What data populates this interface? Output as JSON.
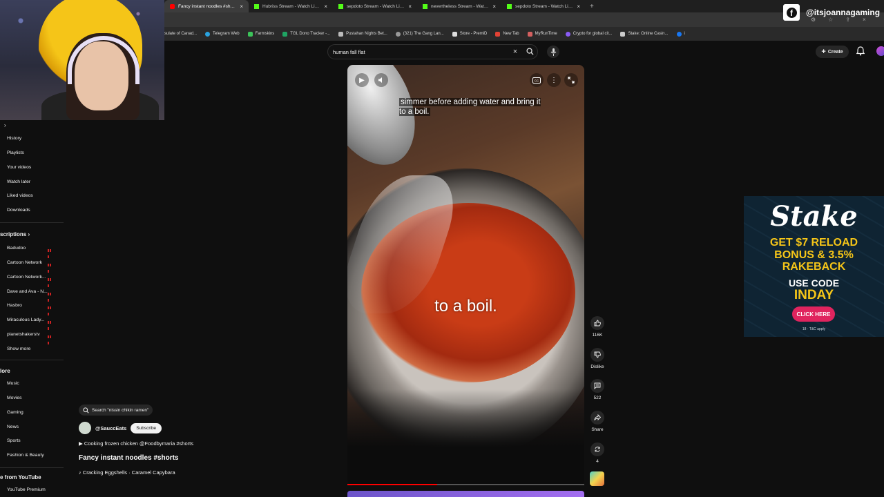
{
  "browser": {
    "tabs": [
      {
        "title": "Fancy instant noodles #shorts",
        "active": true,
        "icon": "youtube-icon"
      },
      {
        "title": "Hubriss Stream - Watch Live o",
        "active": false,
        "icon": "kick-icon"
      },
      {
        "title": "sepdoto Stream - Watch Live o",
        "active": false,
        "icon": "kick-icon"
      },
      {
        "title": "nevertheless Stream - Watch Li",
        "active": false,
        "icon": "kick-icon"
      },
      {
        "title": "sepdoto Stream - Watch Live o",
        "active": false,
        "icon": "kick-icon"
      }
    ],
    "new_tab": "+",
    "bookmarks": [
      {
        "label": "sulate of Canad...",
        "color": "#888888"
      },
      {
        "label": "Telegram Web",
        "color": "#2aa3e0"
      },
      {
        "label": "Farmskins",
        "color": "#3cc45a"
      },
      {
        "label": "TGL Dono Tracker -...",
        "color": "#1fa463"
      },
      {
        "label": "Pustahan Nights Bet...",
        "color": "#bbbbbb"
      },
      {
        "label": "(321) The Gang Lan...",
        "color": "#999999"
      },
      {
        "label": "Store - PremiD",
        "color": "#dddddd"
      },
      {
        "label": "New Tab",
        "color": "#e34234"
      },
      {
        "label": "MyRunTime",
        "color": "#d46060"
      },
      {
        "label": "Crypto for global cit...",
        "color": "#8a5cf5"
      },
      {
        "label": "Stake: Online Casin...",
        "color": "#cccccc"
      },
      {
        "label": "i",
        "color": "#1877f2"
      }
    ]
  },
  "overlay": {
    "facebook_handle": "@itsjoannagaming"
  },
  "header": {
    "search_query": "human fall flat",
    "create_label": "Create"
  },
  "sidebar": {
    "items": [
      "History",
      "Playlists",
      "Your videos",
      "Watch later",
      "Liked videos",
      "Downloads"
    ],
    "subscriptions_title": "scriptions",
    "subscriptions": [
      "Badudoo",
      "Cartoon Network",
      "Cartoon Network...",
      "Dave and Ava - N...",
      "Hasbro",
      "Miraculous Lady...",
      "planetshakerstv"
    ],
    "show_more": "Show more",
    "explore_title": "lore",
    "explore": [
      "Music",
      "Movies",
      "Gaming",
      "News",
      "Sports",
      "Fashion & Beauty"
    ],
    "more_title": "e from YouTube",
    "more": [
      "YouTube Premium"
    ]
  },
  "video": {
    "caption": "simmer before adding water and bring it to a boil.",
    "burned_in_caption": "to a boil.",
    "progress": 0.38,
    "actions": {
      "likes": "116K",
      "dislike": "Dislike",
      "comments": "522",
      "share": "Share",
      "remix": "4"
    }
  },
  "shorts_meta": {
    "search_chip": "Search \"nissin chikin ramen\"",
    "channel": "@SauccEats",
    "subscribe": "Subscribe",
    "related": "Cooking frozen chicken @Foodbymaria #shorts",
    "title": "Fancy instant noodles #shorts",
    "sound": "Cracking Eggshells · Caramel Capybara"
  },
  "ad": {
    "brand": "Stake",
    "line1": "GET $7 RELOAD",
    "line2": "BONUS & 3.5%",
    "line3": "RAKEBACK",
    "use_code": "USE CODE",
    "code": "INDAY",
    "cta": "CLICK HERE",
    "terms": "18 · T&C apply"
  },
  "colors": {
    "youtube_red": "#ff0000",
    "background": "#0f0f0f",
    "stake_gold": "#f5c518",
    "cta_pink": "#e0245e"
  }
}
